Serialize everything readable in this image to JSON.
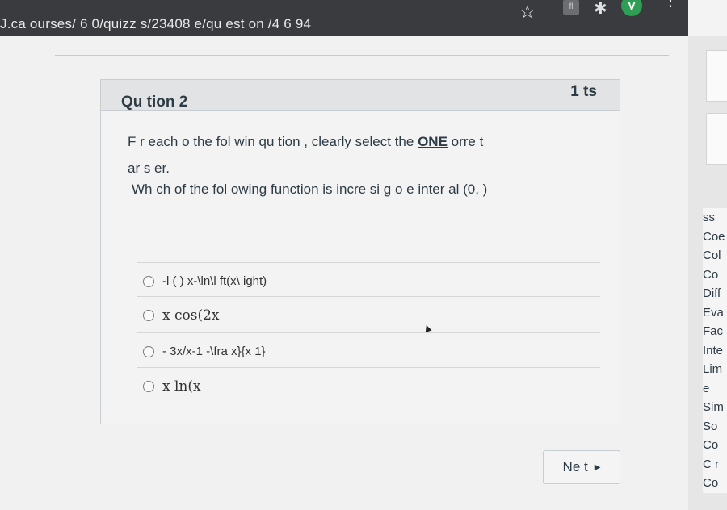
{
  "browser": {
    "url": "J.ca ourses/ 6 0/quizz s/23408 e/qu est on /4 6 94",
    "star": "☆",
    "extension_label": "fl",
    "avatar_letter": "V"
  },
  "question": {
    "title": "Qu tion 2",
    "points": "1 ts",
    "instruction_prefix": "F r each o the fol win qu tion , clearly select the",
    "instruction_emph": "ONE",
    "instruction_suffix": "orre t",
    "instruction_line2": "ar s er.",
    "prompt": "Wh ch of the fol owing function is incre si g o e inter al (0, )",
    "answers": [
      {
        "text": "-l ( ) x-\\ln\\l ft(x\\ ight)"
      },
      {
        "text": "x cos(2x"
      },
      {
        "text": "- 3x/x-1 -\\fra x}{x 1}"
      },
      {
        "text": "x ln(x"
      }
    ]
  },
  "nav": {
    "next_label": "Ne t"
  },
  "right_list": [
    "ss",
    "Coe",
    "Col",
    "Co",
    "Diff",
    "Eva",
    "Fac",
    "Inte",
    "Lim",
    "e",
    "Sim",
    "So",
    "Co",
    "C r",
    "Co"
  ]
}
